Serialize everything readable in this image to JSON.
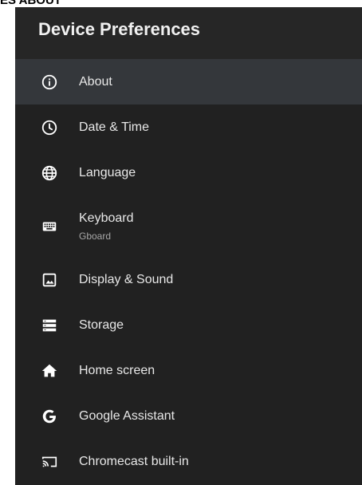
{
  "caption": "ES ABOUT",
  "header": {
    "title": "Device Preferences"
  },
  "menu": {
    "items": [
      {
        "label": "About",
        "icon": "info-icon"
      },
      {
        "label": "Date & Time",
        "icon": "clock-icon"
      },
      {
        "label": "Language",
        "icon": "globe-icon"
      },
      {
        "label": "Keyboard",
        "sublabel": "Gboard",
        "icon": "keyboard-icon"
      },
      {
        "label": "Display & Sound",
        "icon": "image-icon"
      },
      {
        "label": "Storage",
        "icon": "storage-icon"
      },
      {
        "label": "Home screen",
        "icon": "home-icon"
      },
      {
        "label": "Google Assistant",
        "icon": "google-icon"
      },
      {
        "label": "Chromecast built-in",
        "icon": "cast-icon"
      }
    ],
    "selected_index": 0
  },
  "colors": {
    "panel_bg": "#212121",
    "header_bg": "#262626",
    "selected_bg": "#34373b",
    "text": "#e8e8e8",
    "subtext": "#a6a6a6"
  }
}
